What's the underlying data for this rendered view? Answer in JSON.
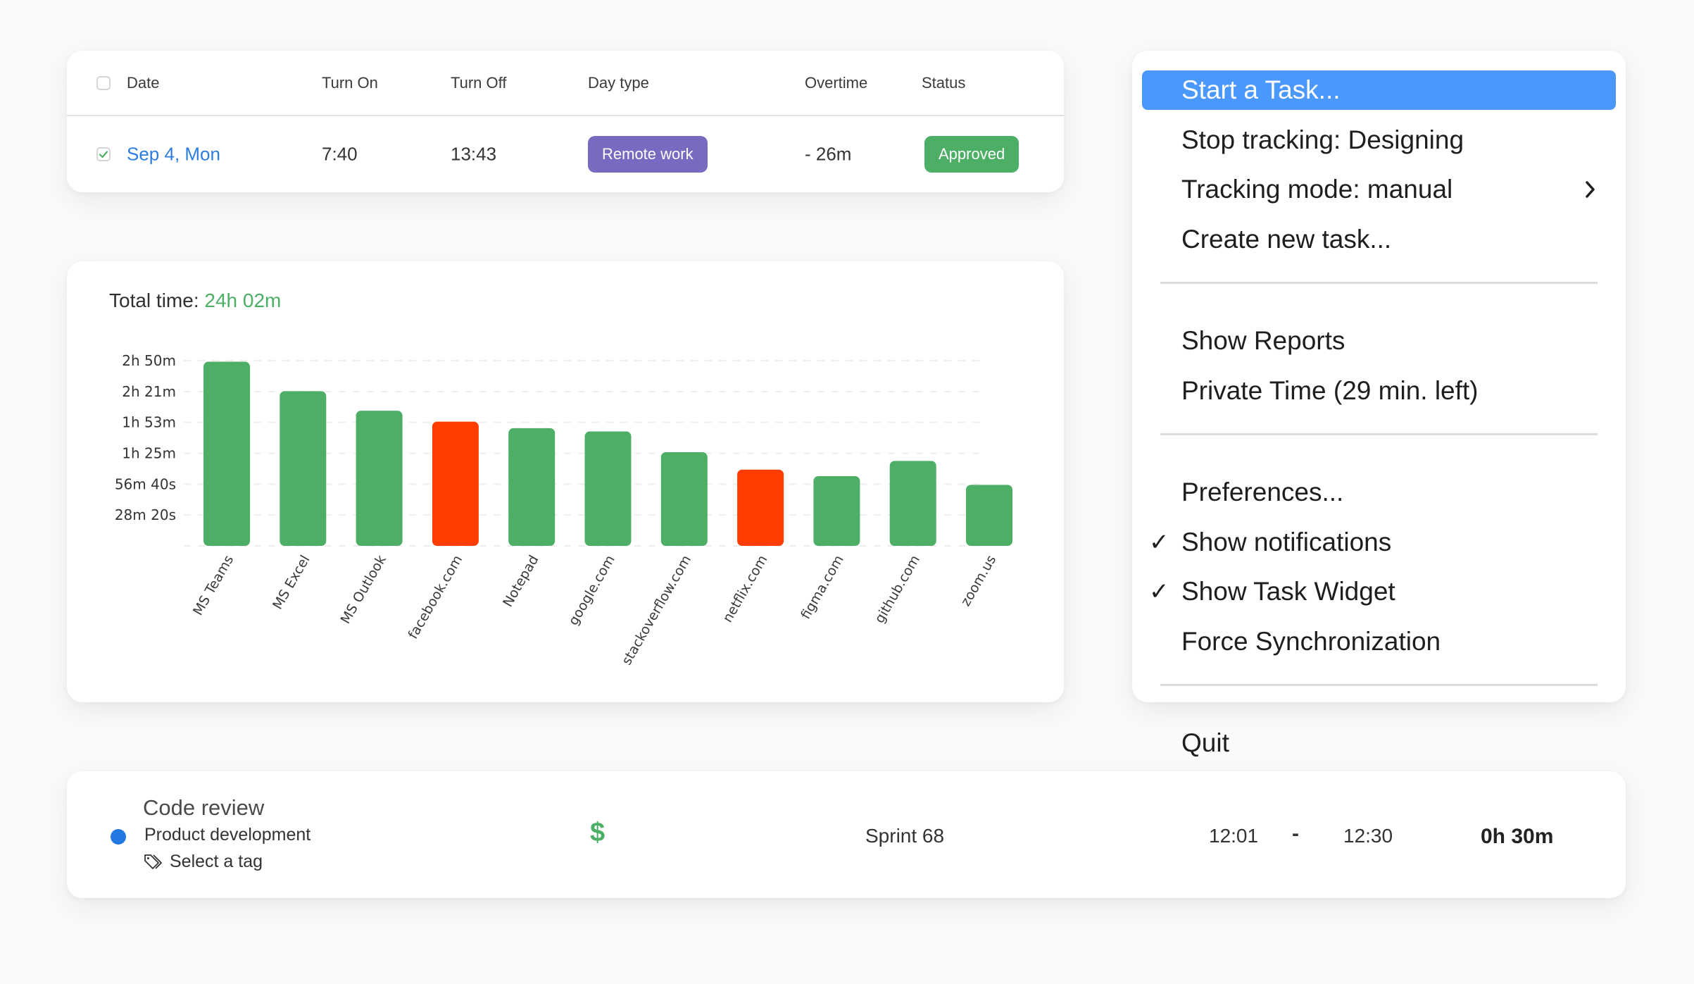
{
  "table": {
    "headers": [
      "Date",
      "Turn On",
      "Turn Off",
      "Day type",
      "Overtime",
      "Status"
    ],
    "header_checked": false,
    "rows": [
      {
        "checked": true,
        "date": "Sep 4, Mon",
        "turn_on": "7:40",
        "turn_off": "13:43",
        "day_type": "Remote work",
        "overtime": "- 26m",
        "status": "Approved"
      }
    ]
  },
  "colors": {
    "productive": "#4caf65",
    "unproductive": "#ff3d00",
    "badge_day_type": "#7a69c1",
    "badge_status": "#4caf65",
    "link": "#2b7de0",
    "menu_highlight": "#4a98fb",
    "project_dot": "#2178e0"
  },
  "chart_summary": {
    "label": "Total time:",
    "value": "24h 02m"
  },
  "chart_data": {
    "type": "bar",
    "title": "Total time: 24h 02m",
    "xlabel": "",
    "ylabel": "",
    "unit": "minutes",
    "categories": [
      "MS Teams",
      "MS Excel",
      "MS Outlook",
      "facebook.com",
      "Notepad",
      "google.com",
      "stackoverflow.com",
      "netflix.com",
      "figma.com",
      "github.com",
      "zoom.us"
    ],
    "values": [
      169,
      142,
      124,
      114,
      108,
      105,
      86,
      70,
      64,
      78,
      56
    ],
    "bar_status": [
      "productive",
      "productive",
      "productive",
      "unproductive",
      "productive",
      "productive",
      "productive",
      "unproductive",
      "productive",
      "productive",
      "productive"
    ],
    "yticks": [
      {
        "value": 28.333,
        "label": "28m 20s"
      },
      {
        "value": 56.667,
        "label": "56m 40s"
      },
      {
        "value": 85,
        "label": "1h 25m"
      },
      {
        "value": 113.333,
        "label": "1h 53m"
      },
      {
        "value": 141.667,
        "label": "2h 21m"
      },
      {
        "value": 170,
        "label": "2h 50m"
      }
    ],
    "ylim": [
      0,
      170
    ],
    "grid": true,
    "grid_style": "dashed",
    "legend": "none",
    "xtick_rotation": "-60deg"
  },
  "menu": {
    "items": [
      {
        "type": "item",
        "label": "Start a Task...",
        "active": true,
        "checked": false,
        "submenu": false
      },
      {
        "type": "item",
        "label": "Stop tracking: Designing",
        "active": false,
        "checked": false,
        "submenu": false
      },
      {
        "type": "item",
        "label": "Tracking mode: manual",
        "active": false,
        "checked": false,
        "submenu": true
      },
      {
        "type": "item",
        "label": "Create new task...",
        "active": false,
        "checked": false,
        "submenu": false
      },
      {
        "type": "separator"
      },
      {
        "type": "item",
        "label": "Show Reports",
        "active": false,
        "checked": false,
        "submenu": false
      },
      {
        "type": "item",
        "label": "Private Time (29 min. left)",
        "active": false,
        "checked": false,
        "submenu": false
      },
      {
        "type": "separator"
      },
      {
        "type": "item",
        "label": "Preferences...",
        "active": false,
        "checked": false,
        "submenu": false
      },
      {
        "type": "item",
        "label": "Show notifications",
        "active": false,
        "checked": true,
        "submenu": false
      },
      {
        "type": "item",
        "label": "Show Task Widget",
        "active": false,
        "checked": true,
        "submenu": false
      },
      {
        "type": "item",
        "label": "Force Synchronization",
        "active": false,
        "checked": false,
        "submenu": false
      },
      {
        "type": "separator"
      },
      {
        "type": "item",
        "label": "Quit",
        "active": false,
        "checked": false,
        "submenu": false
      }
    ],
    "check_glyph": "✓"
  },
  "task": {
    "title": "Code review",
    "project": "Product development",
    "tag_placeholder": "Select a tag",
    "billable_icon": "dollar-icon",
    "billable_glyph": "$",
    "sprint": "Sprint 68",
    "start": "12:01",
    "separator": "-",
    "end": "12:30",
    "duration": "0h 30m"
  }
}
